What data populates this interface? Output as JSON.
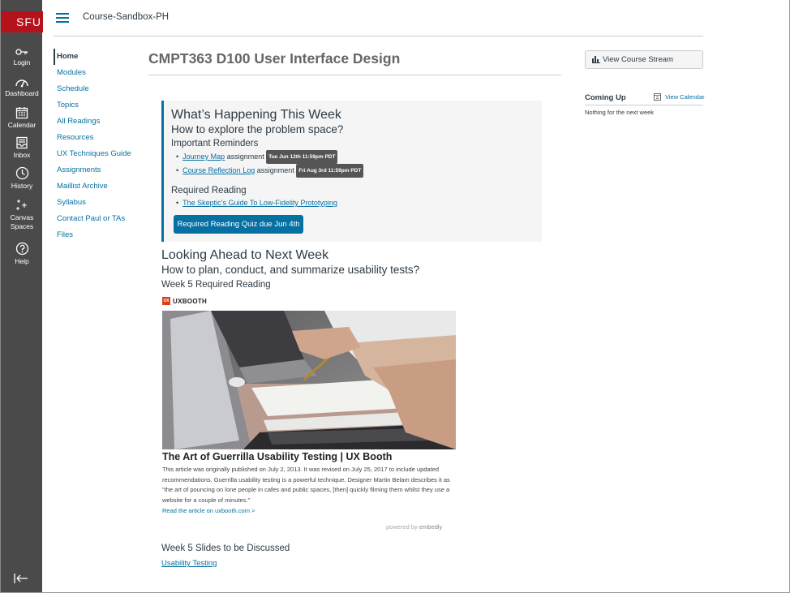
{
  "global_nav": {
    "brand": "SFU",
    "items": [
      {
        "label": "Login",
        "icon": "login-key-icon"
      },
      {
        "label": "Dashboard",
        "icon": "dashboard-icon"
      },
      {
        "label": "Calendar",
        "icon": "calendar-icon"
      },
      {
        "label": "Inbox",
        "icon": "inbox-icon"
      },
      {
        "label": "History",
        "icon": "history-clock-icon"
      },
      {
        "label": "Canvas Spaces",
        "icon": "sparkle-icon"
      },
      {
        "label": "Help",
        "icon": "help-icon"
      }
    ],
    "collapse_icon": "collapse-nav-icon"
  },
  "header": {
    "breadcrumb": "Course-Sandbox-PH"
  },
  "course_nav": {
    "items": [
      "Home",
      "Modules",
      "Schedule",
      "Topics",
      "All Readings",
      "Resources",
      "UX Techniques Guide",
      "Assignments",
      "Maillist Archive",
      "Syllabus",
      "Contact Paul or TAs",
      "Files"
    ],
    "active": "Home"
  },
  "main": {
    "title": "CMPT363 D100 User Interface Design",
    "this_week": {
      "heading": "What’s Happening This Week",
      "subheading": "How to explore the problem space?",
      "reminders_label": "Important Reminders",
      "reminders": [
        {
          "link": "Journey Map",
          "type": " assignment ",
          "due": "Tue Jun 12th 11:59pm PDT"
        },
        {
          "link": "Course Reflection Log",
          "type": " assignment ",
          "due": "Fri Aug 3rd 11:59pm PDT"
        }
      ],
      "reading_label": "Required Reading",
      "reading": "The Skeptic’s Guide To Low-Fidelity Prototyping",
      "quiz_button": "Required Reading Quiz due Jun 4th"
    },
    "next_week": {
      "heading": "Looking Ahead to Next Week",
      "subheading": "How to plan, conduct, and summarize usability tests?",
      "reading_label": "Week 5 Required Reading",
      "embed": {
        "source": "UXBOOTH",
        "source_mark": "UX",
        "title": "The Art of Guerrilla Usability Testing | UX Booth",
        "description": "This article was originally published on July 2, 2013. It was revised on July 25, 2017 to include updated recommendations. Guerrilla usability testing is a powerful technique. Designer Martin Belam describes it as \"the art of pouncing on lone people in cafes and public spaces, [then] quickly filming them whilst they use a website for a couple of minutes.\"",
        "link": "Read the article on uxbooth.com >",
        "powered_prefix": "powered by ",
        "powered_brand": "embedly"
      },
      "slides_label": "Week 5 Slides to be Discussed",
      "slides_link": "Usability Testing"
    }
  },
  "sidebar_right": {
    "stream_button": "View Course Stream",
    "coming_up": "Coming Up",
    "view_calendar": "View Calendar",
    "nothing": "Nothing for the next week"
  },
  "colors": {
    "brand_red": "#b5121b",
    "nav_bg": "#4a4a4a",
    "link_blue": "#0770a3"
  }
}
